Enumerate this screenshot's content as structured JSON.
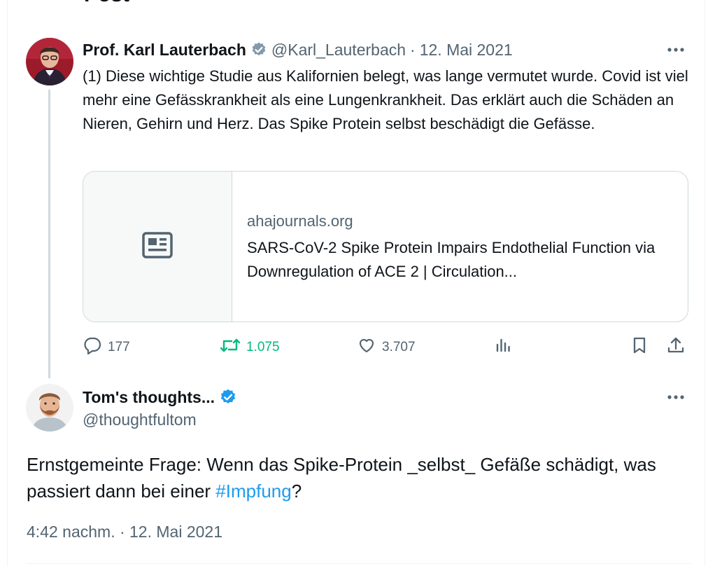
{
  "header": {
    "title": "Post"
  },
  "quoted_tweet": {
    "author_name": "Prof. Karl Lauterbach",
    "handle": "@Karl_Lauterbach",
    "separator": "·",
    "date": "12. Mai 2021",
    "text": "(1) Diese wichtige Studie aus Kalifornien belegt, was lange vermutet wurde. Covid ist viel mehr eine Gefässkrankheit als eine Lungenkrankheit. Das erklärt auch die Schäden an Nieren, Gehirn und Herz. Das Spike Protein selbst beschädigt die Gefässe.",
    "card": {
      "domain": "ahajournals.org",
      "title": "SARS-CoV-2 Spike Protein Impairs Endothelial Function via Downregulation of ACE 2 | Circulation..."
    },
    "actions": {
      "replies": "177",
      "reposts": "1.075",
      "likes": "3.707"
    }
  },
  "reply_tweet": {
    "author_name": "Tom's thoughts...",
    "handle": "@thoughtfultom",
    "text_before": "Ernstgemeinte Frage: Wenn das Spike-Protein _selbst_ Gefäße schädigt, was passiert dann bei einer ",
    "hashtag": "#Impfung",
    "text_after": "?",
    "timestamp": "4:42 nachm. · 12. Mai 2021"
  },
  "colors": {
    "text": "#0f1419",
    "muted": "#536471",
    "accent": "#1d9bf0",
    "repost_green": "#00ba7c",
    "border": "#cfd9de"
  },
  "icons": [
    "verified-badge-icon",
    "more-icon",
    "article-icon",
    "reply-icon",
    "repost-icon",
    "like-icon",
    "views-icon",
    "bookmark-icon",
    "share-icon"
  ]
}
